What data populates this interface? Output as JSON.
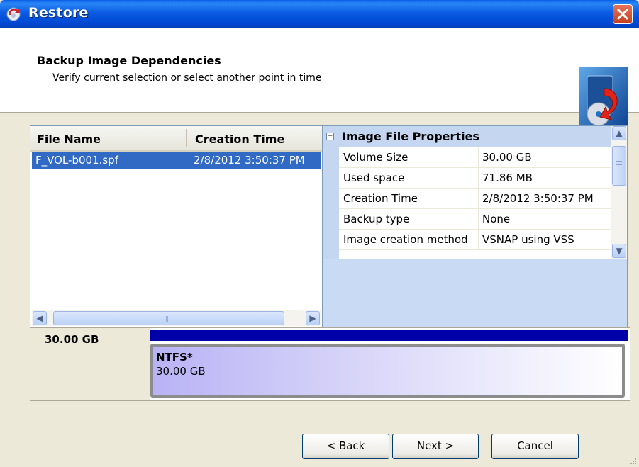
{
  "window": {
    "title": "Restore",
    "app_icon": "restore-wizard-icon",
    "close_icon": "close-icon"
  },
  "header": {
    "title": "Backup Image Dependencies",
    "subtitle": "Verify current selection or select another point in time",
    "image": "restore-disc-icon"
  },
  "file_list": {
    "columns": [
      "File Name",
      "Creation Time"
    ],
    "rows": [
      {
        "file_name": "F_VOL-b001.spf",
        "creation_time": "2/8/2012 3:50:37 PM",
        "selected": true
      }
    ]
  },
  "properties": {
    "category": "Image File Properties",
    "rows": [
      {
        "name": "Volume Size",
        "value": "30.00 GB"
      },
      {
        "name": "Used space",
        "value": "71.86 MB"
      },
      {
        "name": "Creation Time",
        "value": "2/8/2012 3:50:37 PM"
      },
      {
        "name": "Backup type",
        "value": "None"
      },
      {
        "name": "Image creation method",
        "value": "VSNAP using VSS"
      }
    ]
  },
  "disk": {
    "size": "30.00 GB",
    "partition": {
      "filesystem": "NTFS*",
      "size": "30.00 GB"
    }
  },
  "buttons": {
    "back": "< Back",
    "next": "Next >",
    "cancel": "Cancel"
  },
  "colors": {
    "title_bar": "#0054e3",
    "selection": "#316ac5",
    "disk_bar": "#0000a8",
    "panel_bg": "#ece9d8"
  }
}
